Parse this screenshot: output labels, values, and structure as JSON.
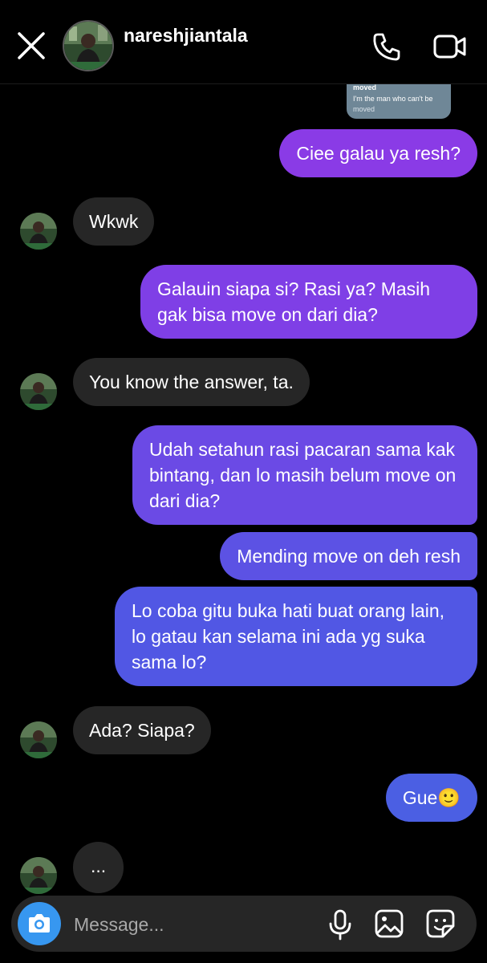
{
  "header": {
    "username": "nareshjiantala"
  },
  "shared_post": {
    "line1": "moved",
    "line2": "I'm the man who can't be",
    "line3": "moved"
  },
  "messages": [
    {
      "from": "me",
      "text": "Ciee galau ya resh?"
    },
    {
      "from": "them",
      "text": "Wkwk"
    },
    {
      "from": "me",
      "text": "Galauin siapa si? Rasi ya? Masih gak bisa move on dari dia?"
    },
    {
      "from": "them",
      "text": "You know the answer, ta."
    },
    {
      "from": "me",
      "text": "Udah setahun rasi pacaran sama kak bintang, dan lo masih belum move on dari dia?"
    },
    {
      "from": "me",
      "text": "Mending move on deh resh"
    },
    {
      "from": "me",
      "text": "Lo coba gitu buka hati buat orang lain, lo gatau kan selama ini ada yg suka sama lo?"
    },
    {
      "from": "them",
      "text": "Ada? Siapa?"
    },
    {
      "from": "me",
      "text": "Gue🙂"
    },
    {
      "from": "them",
      "text": "..."
    }
  ],
  "composer": {
    "placeholder": "Message..."
  },
  "colors": {
    "background": "#000000",
    "incoming_bubble": "#262626",
    "outgoing_top": "#8a3be6",
    "outgoing_bottom": "#4b5fe3",
    "camera_button": "#3797f0"
  }
}
